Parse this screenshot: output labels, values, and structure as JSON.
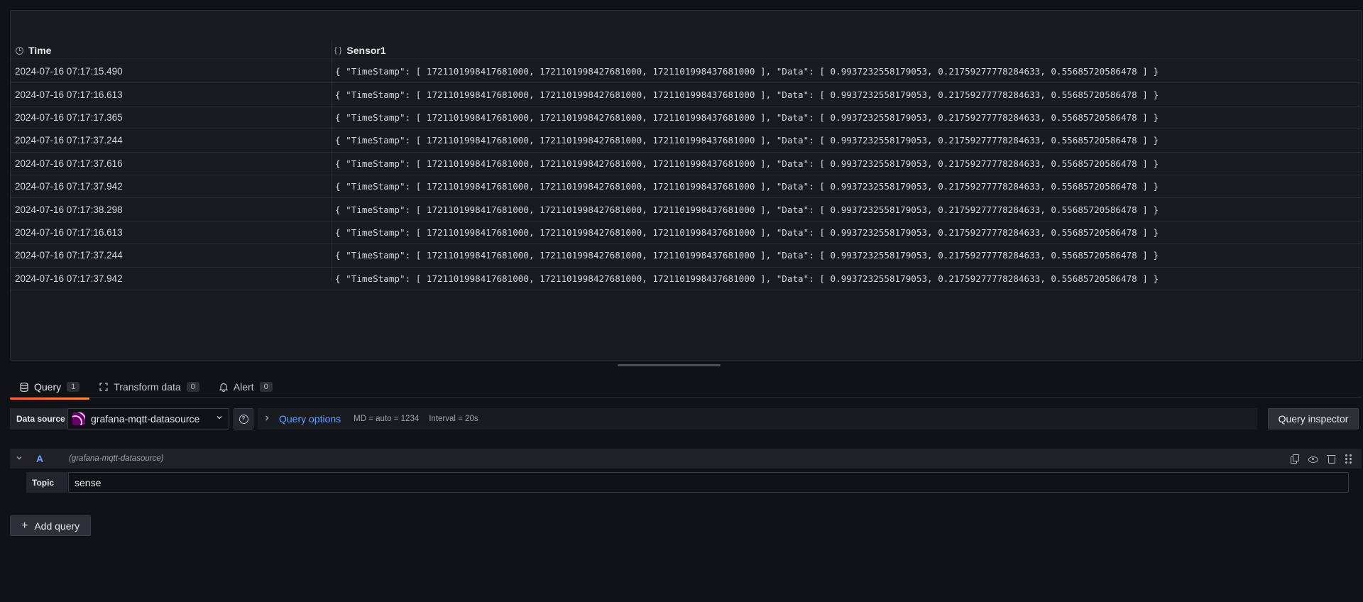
{
  "table": {
    "columns": [
      {
        "label": "Time",
        "icon": "clock-icon"
      },
      {
        "label": "Sensor1",
        "icon": "braces-icon"
      }
    ],
    "rows": [
      {
        "time": "2024-07-16 07:17:15.490",
        "sensor1": "{ \"TimeStamp\": [ 1721101998417681000, 1721101998427681000, 1721101998437681000 ], \"Data\": [ 0.9937232558179053, 0.21759277778284633, 0.556857205864​78 ] }"
      },
      {
        "time": "2024-07-16 07:17:16.613",
        "sensor1": "{ \"TimeStamp\": [ 1721101998417681000, 1721101998427681000, 1721101998437681000 ], \"Data\": [ 0.9937232558179053, 0.21759277778284633, 0.55685720586478 ] }"
      },
      {
        "time": "2024-07-16 07:17:17.365",
        "sensor1": "{ \"TimeStamp\": [ 1721101998417681000, 1721101998427681000, 1721101998437681000 ], \"Data\": [ 0.9937232558179053, 0.21759277778284633, 0.55685720586478 ] }"
      },
      {
        "time": "2024-07-16 07:17:37.244",
        "sensor1": "{ \"TimeStamp\": [ 1721101998417681000, 1721101998427681000, 1721101998437681000 ], \"Data\": [ 0.9937232558179053, 0.21759277778284633, 0.55685720586478 ] }"
      },
      {
        "time": "2024-07-16 07:17:37.616",
        "sensor1": "{ \"TimeStamp\": [ 1721101998417681000, 1721101998427681000, 1721101998437681000 ], \"Data\": [ 0.9937232558179053, 0.21759277778284633, 0.55685720586478 ] }"
      },
      {
        "time": "2024-07-16 07:17:37.942",
        "sensor1": "{ \"TimeStamp\": [ 1721101998417681000, 1721101998427681000, 1721101998437681000 ], \"Data\": [ 0.9937232558179053, 0.21759277778284633, 0.55685720586478 ] }"
      },
      {
        "time": "2024-07-16 07:17:38.298",
        "sensor1": "{ \"TimeStamp\": [ 1721101998417681000, 1721101998427681000, 1721101998437681000 ], \"Data\": [ 0.9937232558179053, 0.21759277778284633, 0.55685720586478 ] }"
      },
      {
        "time": "2024-07-16 07:17:16.613",
        "sensor1": "{ \"TimeStamp\": [ 1721101998417681000, 1721101998427681000, 1721101998437681000 ], \"Data\": [ 0.9937232558179053, 0.21759277778284633, 0.55685720586478 ] }"
      },
      {
        "time": "2024-07-16 07:17:37.244",
        "sensor1": "{ \"TimeStamp\": [ 1721101998417681000, 1721101998427681000, 1721101998437681000 ], \"Data\": [ 0.9937232558179053, 0.21759277778284633, 0.55685720586478 ] }"
      },
      {
        "time": "2024-07-16 07:17:37.942",
        "sensor1": "{ \"TimeStamp\": [ 1721101998417681000, 1721101998427681000, 1721101998437681000 ], \"Data\": [ 0.9937232558179053, 0.21759277778284633, 0.55685720586478 ] }"
      }
    ]
  },
  "tabs": [
    {
      "label": "Query",
      "count": "1",
      "icon": "database-icon",
      "active": true
    },
    {
      "label": "Transform data",
      "count": "0",
      "icon": "transform-icon",
      "active": false
    },
    {
      "label": "Alert",
      "count": "0",
      "icon": "bell-icon",
      "active": false
    }
  ],
  "toolbar": {
    "datasource_label": "Data source",
    "datasource_value": "grafana-mqtt-datasource",
    "query_options_label": "Query options",
    "md_text": "MD = auto = 1234",
    "interval_text": "Interval = 20s",
    "inspector_label": "Query inspector"
  },
  "query": {
    "ref_id": "A",
    "datasource_name": "(grafana-mqtt-datasource)",
    "topic_label": "Topic",
    "topic_value": "sense"
  },
  "add_query_label": "Add query",
  "colors": {
    "background": "#111217",
    "panel": "#181b1f",
    "accent_blue": "#6e9fff",
    "tab_underline": "#f55f3e"
  }
}
